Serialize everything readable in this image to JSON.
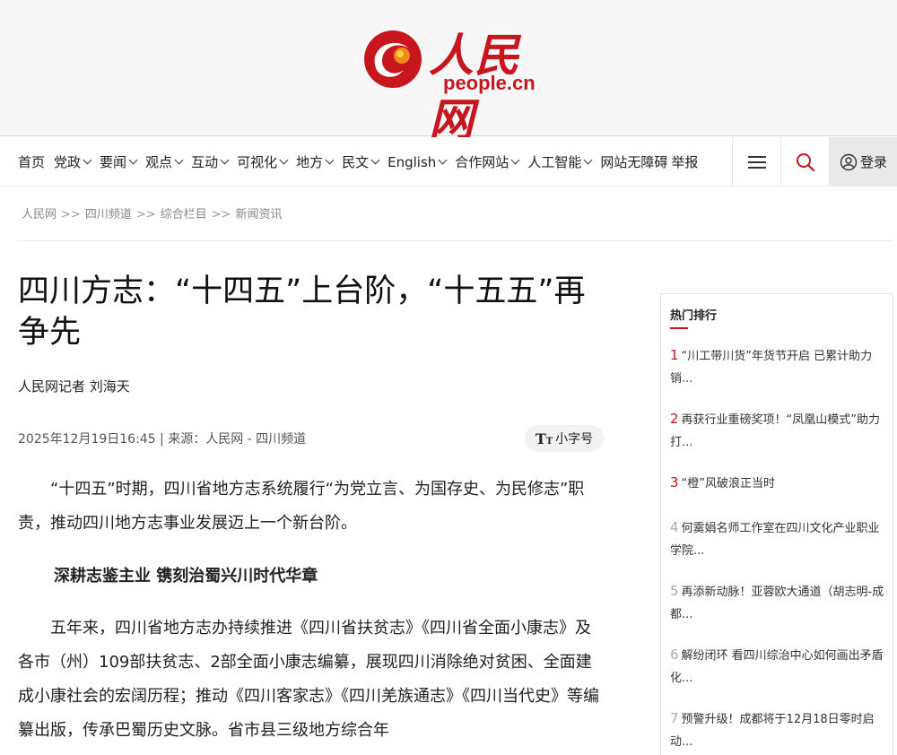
{
  "site": {
    "logo_cn": "人民网",
    "logo_en": "people.cn"
  },
  "nav": {
    "items": [
      {
        "label": "首页",
        "dropdown": false
      },
      {
        "label": "党政",
        "dropdown": true
      },
      {
        "label": "要闻",
        "dropdown": true
      },
      {
        "label": "观点",
        "dropdown": true
      },
      {
        "label": "互动",
        "dropdown": true
      },
      {
        "label": "可视化",
        "dropdown": true
      },
      {
        "label": "地方",
        "dropdown": true
      },
      {
        "label": "民文",
        "dropdown": true
      },
      {
        "label": "English",
        "dropdown": true
      },
      {
        "label": "合作网站",
        "dropdown": true
      },
      {
        "label": "人工智能",
        "dropdown": true
      },
      {
        "label": "网站无障碍",
        "dropdown": false
      },
      {
        "label": "举报",
        "dropdown": false
      }
    ],
    "login_label": "登录",
    "menu_icon": "menu-icon",
    "search_icon": "search-icon",
    "accent_color": "#c7161e"
  },
  "breadcrumb": [
    "人民网",
    "四川频道",
    "综合栏目",
    "新闻资讯"
  ],
  "breadcrumb_sep": ">>",
  "article": {
    "title": "四川方志：“十四五”上台阶，“十五五”再争先",
    "author": "人民网记者 刘海天",
    "meta": "2025年12月19日16:45 | 来源：人民网 - 四川频道",
    "font_size_label": "小字号",
    "paragraphs": [
      "“十四五”时期，四川省地方志系统履行“为党立言、为国存史、为民修志”职责，推动四川地方志事业发展迈上一个新台阶。",
      "五年来，四川省地方志办持续推进《四川省扶贫志》《四川省全面小康志》及各市（州）109部扶贫志、2部全面小康志编纂，展现四川消除绝对贫困、全面建成小康社会的宏阔历程；推动《四川客家志》《四川羌族通志》《四川当代史》等编纂出版，传承巴蜀历史文脉。省市县三级地方综合年"
    ],
    "subheading": "深耕志鉴主业 镌刻治蜀兴川时代华章"
  },
  "sidebar": {
    "title": "热门排行",
    "items": [
      {
        "num": "1",
        "text": "“川工带川货”年货节开启 已累计助力销..."
      },
      {
        "num": "2",
        "text": "再获行业重磅奖项！“凤凰山模式”助力打..."
      },
      {
        "num": "3",
        "text": "“橙”风破浪正当时"
      },
      {
        "num": "4",
        "text": "何霙娟名师工作室在四川文化产业职业学院..."
      },
      {
        "num": "5",
        "text": "再添新动脉！亚蓉欧大通道（胡志明-成都..."
      },
      {
        "num": "6",
        "text": "解纷闭环 看四川综治中心如何画出矛盾化..."
      },
      {
        "num": "7",
        "text": "预警升级！成都将于12月18日零时启动..."
      }
    ]
  }
}
